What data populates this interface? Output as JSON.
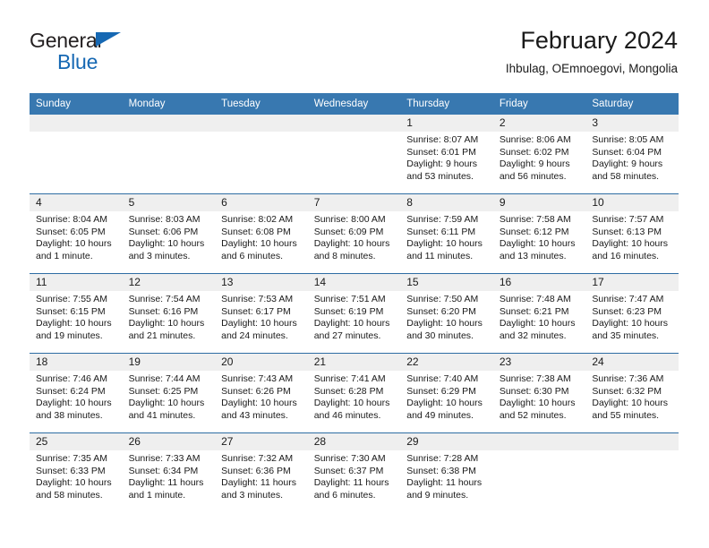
{
  "brand": {
    "word1": "General",
    "word2": "Blue",
    "triangle_color": "#1668b3",
    "text_color": "#231f20"
  },
  "header": {
    "title": "February 2024",
    "subtitle": "Ihbulag, OEmnoegovi, Mongolia"
  },
  "theme": {
    "header_blue": "#3878b0",
    "rule_blue": "#2e6da4",
    "daynum_band": "#efefef"
  },
  "calendar": {
    "weekdays": [
      "Sunday",
      "Monday",
      "Tuesday",
      "Wednesday",
      "Thursday",
      "Friday",
      "Saturday"
    ],
    "weeks": [
      [
        {
          "day": "",
          "sunrise": "",
          "sunset": "",
          "daylight_1": "",
          "daylight_2": ""
        },
        {
          "day": "",
          "sunrise": "",
          "sunset": "",
          "daylight_1": "",
          "daylight_2": ""
        },
        {
          "day": "",
          "sunrise": "",
          "sunset": "",
          "daylight_1": "",
          "daylight_2": ""
        },
        {
          "day": "",
          "sunrise": "",
          "sunset": "",
          "daylight_1": "",
          "daylight_2": ""
        },
        {
          "day": "1",
          "sunrise": "Sunrise: 8:07 AM",
          "sunset": "Sunset: 6:01 PM",
          "daylight_1": "Daylight: 9 hours",
          "daylight_2": "and 53 minutes."
        },
        {
          "day": "2",
          "sunrise": "Sunrise: 8:06 AM",
          "sunset": "Sunset: 6:02 PM",
          "daylight_1": "Daylight: 9 hours",
          "daylight_2": "and 56 minutes."
        },
        {
          "day": "3",
          "sunrise": "Sunrise: 8:05 AM",
          "sunset": "Sunset: 6:04 PM",
          "daylight_1": "Daylight: 9 hours",
          "daylight_2": "and 58 minutes."
        }
      ],
      [
        {
          "day": "4",
          "sunrise": "Sunrise: 8:04 AM",
          "sunset": "Sunset: 6:05 PM",
          "daylight_1": "Daylight: 10 hours",
          "daylight_2": "and 1 minute."
        },
        {
          "day": "5",
          "sunrise": "Sunrise: 8:03 AM",
          "sunset": "Sunset: 6:06 PM",
          "daylight_1": "Daylight: 10 hours",
          "daylight_2": "and 3 minutes."
        },
        {
          "day": "6",
          "sunrise": "Sunrise: 8:02 AM",
          "sunset": "Sunset: 6:08 PM",
          "daylight_1": "Daylight: 10 hours",
          "daylight_2": "and 6 minutes."
        },
        {
          "day": "7",
          "sunrise": "Sunrise: 8:00 AM",
          "sunset": "Sunset: 6:09 PM",
          "daylight_1": "Daylight: 10 hours",
          "daylight_2": "and 8 minutes."
        },
        {
          "day": "8",
          "sunrise": "Sunrise: 7:59 AM",
          "sunset": "Sunset: 6:11 PM",
          "daylight_1": "Daylight: 10 hours",
          "daylight_2": "and 11 minutes."
        },
        {
          "day": "9",
          "sunrise": "Sunrise: 7:58 AM",
          "sunset": "Sunset: 6:12 PM",
          "daylight_1": "Daylight: 10 hours",
          "daylight_2": "and 13 minutes."
        },
        {
          "day": "10",
          "sunrise": "Sunrise: 7:57 AM",
          "sunset": "Sunset: 6:13 PM",
          "daylight_1": "Daylight: 10 hours",
          "daylight_2": "and 16 minutes."
        }
      ],
      [
        {
          "day": "11",
          "sunrise": "Sunrise: 7:55 AM",
          "sunset": "Sunset: 6:15 PM",
          "daylight_1": "Daylight: 10 hours",
          "daylight_2": "and 19 minutes."
        },
        {
          "day": "12",
          "sunrise": "Sunrise: 7:54 AM",
          "sunset": "Sunset: 6:16 PM",
          "daylight_1": "Daylight: 10 hours",
          "daylight_2": "and 21 minutes."
        },
        {
          "day": "13",
          "sunrise": "Sunrise: 7:53 AM",
          "sunset": "Sunset: 6:17 PM",
          "daylight_1": "Daylight: 10 hours",
          "daylight_2": "and 24 minutes."
        },
        {
          "day": "14",
          "sunrise": "Sunrise: 7:51 AM",
          "sunset": "Sunset: 6:19 PM",
          "daylight_1": "Daylight: 10 hours",
          "daylight_2": "and 27 minutes."
        },
        {
          "day": "15",
          "sunrise": "Sunrise: 7:50 AM",
          "sunset": "Sunset: 6:20 PM",
          "daylight_1": "Daylight: 10 hours",
          "daylight_2": "and 30 minutes."
        },
        {
          "day": "16",
          "sunrise": "Sunrise: 7:48 AM",
          "sunset": "Sunset: 6:21 PM",
          "daylight_1": "Daylight: 10 hours",
          "daylight_2": "and 32 minutes."
        },
        {
          "day": "17",
          "sunrise": "Sunrise: 7:47 AM",
          "sunset": "Sunset: 6:23 PM",
          "daylight_1": "Daylight: 10 hours",
          "daylight_2": "and 35 minutes."
        }
      ],
      [
        {
          "day": "18",
          "sunrise": "Sunrise: 7:46 AM",
          "sunset": "Sunset: 6:24 PM",
          "daylight_1": "Daylight: 10 hours",
          "daylight_2": "and 38 minutes."
        },
        {
          "day": "19",
          "sunrise": "Sunrise: 7:44 AM",
          "sunset": "Sunset: 6:25 PM",
          "daylight_1": "Daylight: 10 hours",
          "daylight_2": "and 41 minutes."
        },
        {
          "day": "20",
          "sunrise": "Sunrise: 7:43 AM",
          "sunset": "Sunset: 6:26 PM",
          "daylight_1": "Daylight: 10 hours",
          "daylight_2": "and 43 minutes."
        },
        {
          "day": "21",
          "sunrise": "Sunrise: 7:41 AM",
          "sunset": "Sunset: 6:28 PM",
          "daylight_1": "Daylight: 10 hours",
          "daylight_2": "and 46 minutes."
        },
        {
          "day": "22",
          "sunrise": "Sunrise: 7:40 AM",
          "sunset": "Sunset: 6:29 PM",
          "daylight_1": "Daylight: 10 hours",
          "daylight_2": "and 49 minutes."
        },
        {
          "day": "23",
          "sunrise": "Sunrise: 7:38 AM",
          "sunset": "Sunset: 6:30 PM",
          "daylight_1": "Daylight: 10 hours",
          "daylight_2": "and 52 minutes."
        },
        {
          "day": "24",
          "sunrise": "Sunrise: 7:36 AM",
          "sunset": "Sunset: 6:32 PM",
          "daylight_1": "Daylight: 10 hours",
          "daylight_2": "and 55 minutes."
        }
      ],
      [
        {
          "day": "25",
          "sunrise": "Sunrise: 7:35 AM",
          "sunset": "Sunset: 6:33 PM",
          "daylight_1": "Daylight: 10 hours",
          "daylight_2": "and 58 minutes."
        },
        {
          "day": "26",
          "sunrise": "Sunrise: 7:33 AM",
          "sunset": "Sunset: 6:34 PM",
          "daylight_1": "Daylight: 11 hours",
          "daylight_2": "and 1 minute."
        },
        {
          "day": "27",
          "sunrise": "Sunrise: 7:32 AM",
          "sunset": "Sunset: 6:36 PM",
          "daylight_1": "Daylight: 11 hours",
          "daylight_2": "and 3 minutes."
        },
        {
          "day": "28",
          "sunrise": "Sunrise: 7:30 AM",
          "sunset": "Sunset: 6:37 PM",
          "daylight_1": "Daylight: 11 hours",
          "daylight_2": "and 6 minutes."
        },
        {
          "day": "29",
          "sunrise": "Sunrise: 7:28 AM",
          "sunset": "Sunset: 6:38 PM",
          "daylight_1": "Daylight: 11 hours",
          "daylight_2": "and 9 minutes."
        },
        {
          "day": "",
          "sunrise": "",
          "sunset": "",
          "daylight_1": "",
          "daylight_2": ""
        },
        {
          "day": "",
          "sunrise": "",
          "sunset": "",
          "daylight_1": "",
          "daylight_2": ""
        }
      ]
    ]
  }
}
